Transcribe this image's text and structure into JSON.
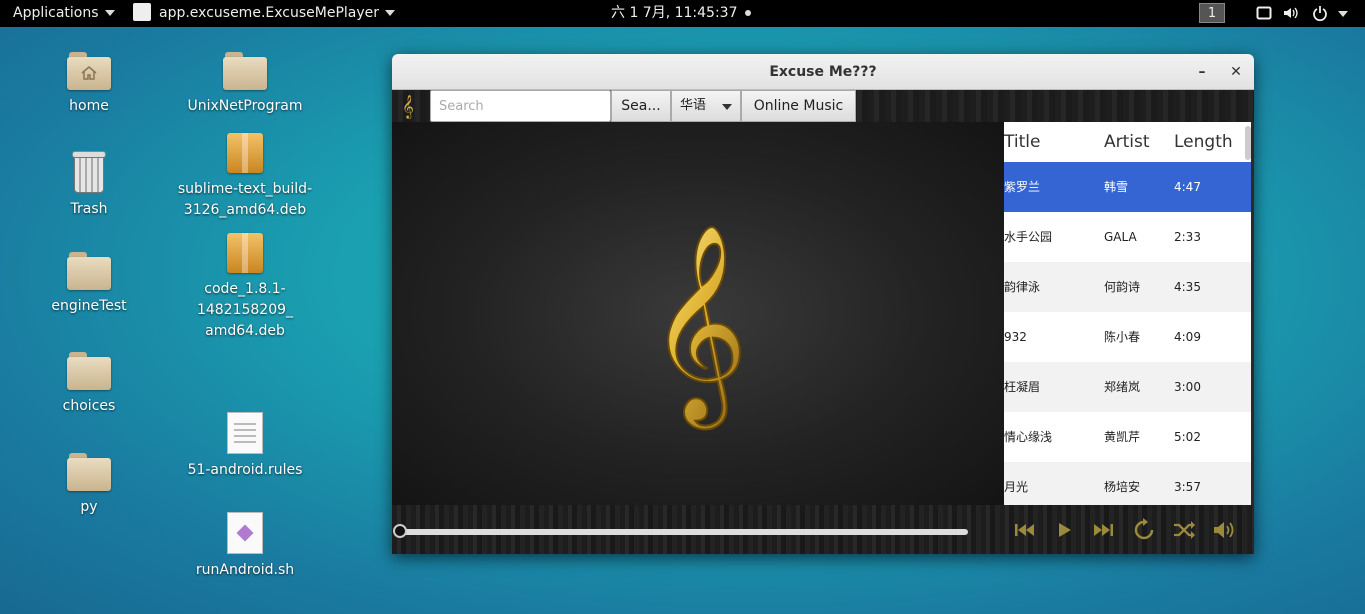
{
  "topbar": {
    "applications": "Applications",
    "app_name": "app.excuseme.ExcuseMePlayer",
    "clock": "六 1 7月, 11:45:37",
    "workspace": "1"
  },
  "desktop": {
    "col1": [
      "home",
      "Trash",
      "engineTest",
      "choices",
      "py"
    ],
    "unix": "UnixNetProgram",
    "sublime_1": "sublime-text_build-",
    "sublime_2": "3126_amd64.deb",
    "code_1": "code_1.8.1-",
    "code_2": "1482158209_",
    "code_3": "amd64.deb",
    "rules": "51-android.rules",
    "run": "runAndroid.sh"
  },
  "window": {
    "title": "Excuse Me???",
    "minimize": "–",
    "close": "✕"
  },
  "toolbar": {
    "search_placeholder": "Search",
    "search_button": "Sea...",
    "language": "华语",
    "online_button": "Online Music"
  },
  "playlist": {
    "columns": {
      "title": "Title",
      "artist": "Artist",
      "length": "Length"
    },
    "rows": [
      {
        "title": "紫罗兰",
        "artist": "韩雪",
        "length": "4:47"
      },
      {
        "title": "水手公园",
        "artist": "GALA",
        "length": "2:33"
      },
      {
        "title": "韵律泳",
        "artist": "何韵诗",
        "length": "4:35"
      },
      {
        "title": "932",
        "artist": "陈小春",
        "length": "4:09"
      },
      {
        "title": "枉凝眉",
        "artist": "郑绪岚",
        "length": "3:00"
      },
      {
        "title": "情心缘浅",
        "artist": "黄凯芹",
        "length": "5:02"
      },
      {
        "title": "月光",
        "artist": "杨培安",
        "length": "3:57"
      }
    ],
    "selected_index": 0
  },
  "player": {
    "progress": 0,
    "accent_color": "#d4b040",
    "icons": [
      "prev-icon",
      "play-icon",
      "next-icon",
      "repeat-icon",
      "shuffle-icon",
      "volume-icon"
    ]
  }
}
